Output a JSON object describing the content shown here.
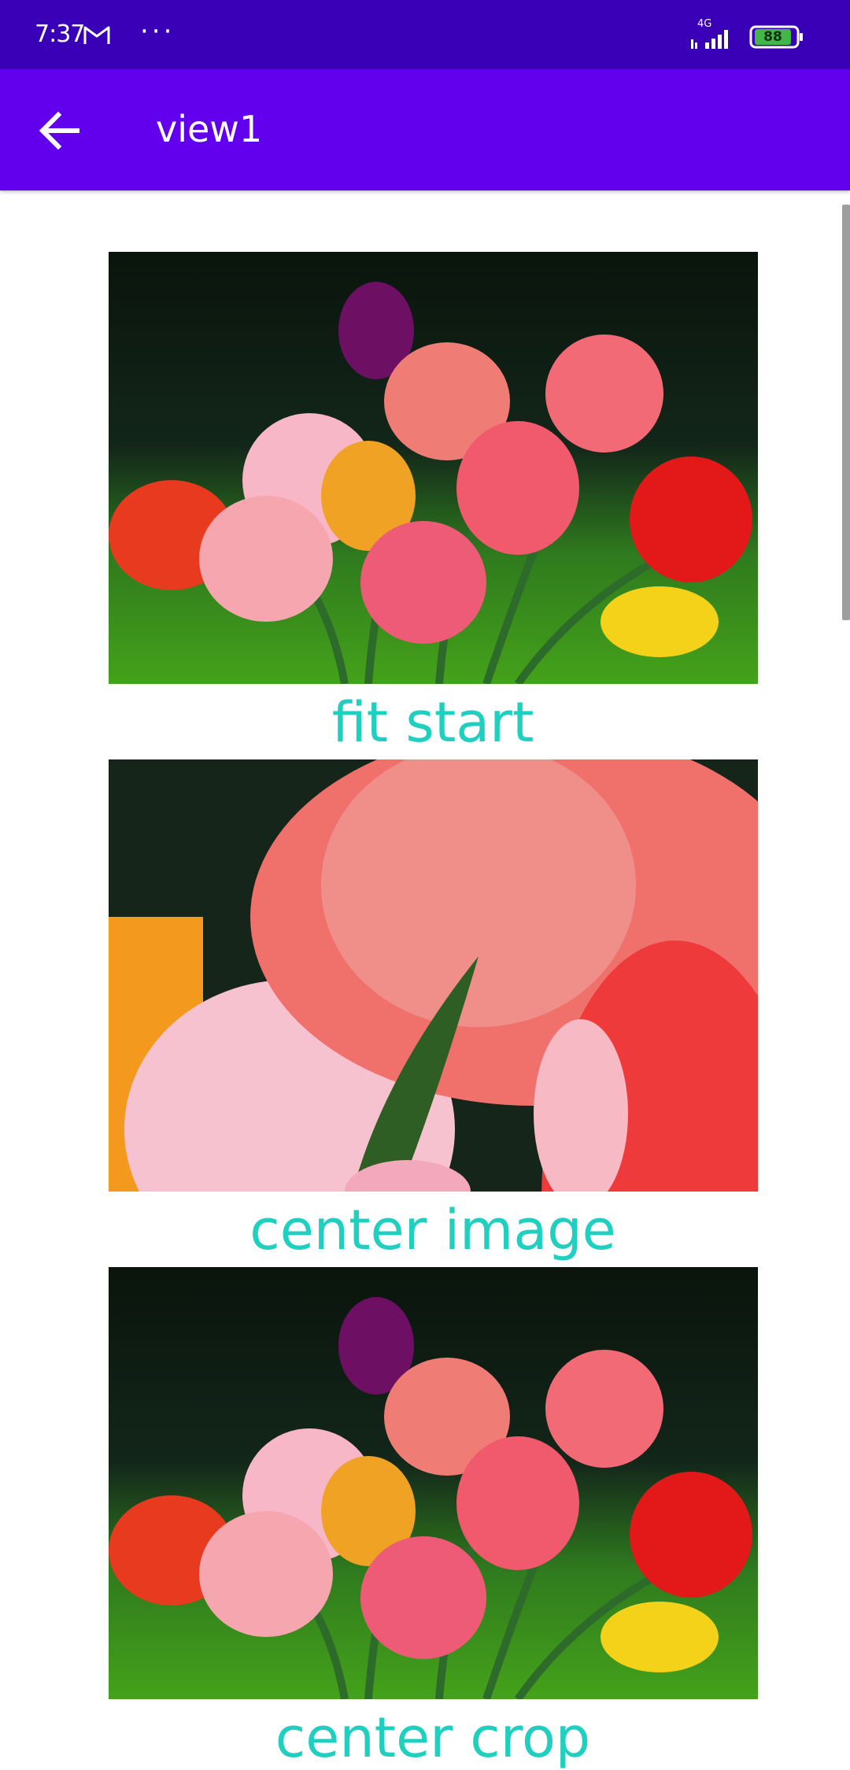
{
  "status_bar": {
    "time": "7:37",
    "mail_icon": "gmail-icon",
    "more": "···",
    "network": "4G",
    "battery": "88"
  },
  "app_bar": {
    "back_icon": "arrow-back-icon",
    "title": "view1"
  },
  "items": [
    {
      "caption": "fit start",
      "image": "tulip-bouquet"
    },
    {
      "caption": "center image",
      "image": "tulip-closeup"
    },
    {
      "caption": "center crop",
      "image": "tulip-bouquet"
    }
  ],
  "colors": {
    "status_bar": "#3a00b8",
    "app_bar": "#6200ee",
    "caption": "#1fcfc0"
  }
}
